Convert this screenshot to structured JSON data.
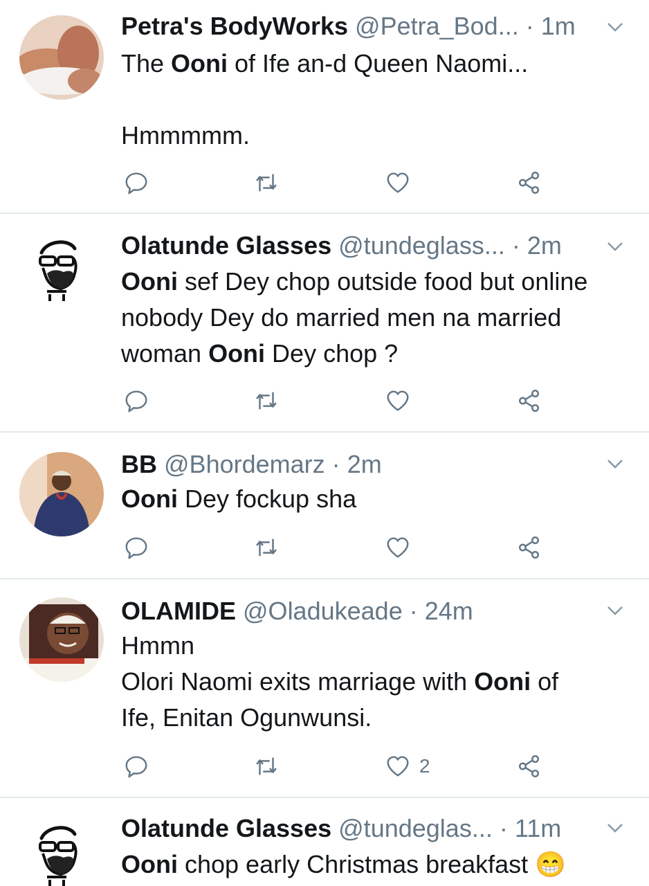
{
  "tweets": [
    {
      "name": "Petra's BodyWorks",
      "handle": "@Petra_Bod...",
      "time": "1m",
      "lines": [
        [
          "The ",
          {
            "b": "Ooni"
          },
          " of Ife an-d Queen Naomi..."
        ],
        [],
        [
          "Hmmmmm."
        ]
      ],
      "likes": ""
    },
    {
      "name": "Olatunde Glasses",
      "handle": "@tundeglass...",
      "time": "2m",
      "lines": [
        [
          {
            "b": "Ooni"
          },
          " sef Dey chop outside food but online"
        ],
        [
          "nobody Dey do married men na married"
        ],
        [
          "woman ",
          {
            "b": "Ooni"
          },
          " Dey chop ?"
        ]
      ],
      "likes": ""
    },
    {
      "name": "BB",
      "handle": "@Bhordemarz",
      "time": "2m",
      "lines": [
        [
          {
            "b": "Ooni"
          },
          " Dey fockup sha"
        ]
      ],
      "likes": ""
    },
    {
      "name": "OLAMIDE",
      "handle": "@Oladukeade",
      "time": "24m",
      "lines": [
        [
          "Hmmn"
        ],
        [
          "Olori Naomi exits marriage with ",
          {
            "b": "Ooni"
          },
          " of"
        ],
        [
          "Ife, Enitan Ogunwunsi."
        ]
      ],
      "likes": "2"
    },
    {
      "name": "Olatunde Glasses",
      "handle": "@tundeglas...",
      "time": "11m",
      "lines": [
        [
          {
            "b": "Ooni"
          },
          " chop early Christmas breakfast 😁"
        ]
      ],
      "likes": ""
    }
  ],
  "dot": "·",
  "colors": {
    "text": "#14171a",
    "secondary": "#657786",
    "divider": "#e1e8ed"
  }
}
